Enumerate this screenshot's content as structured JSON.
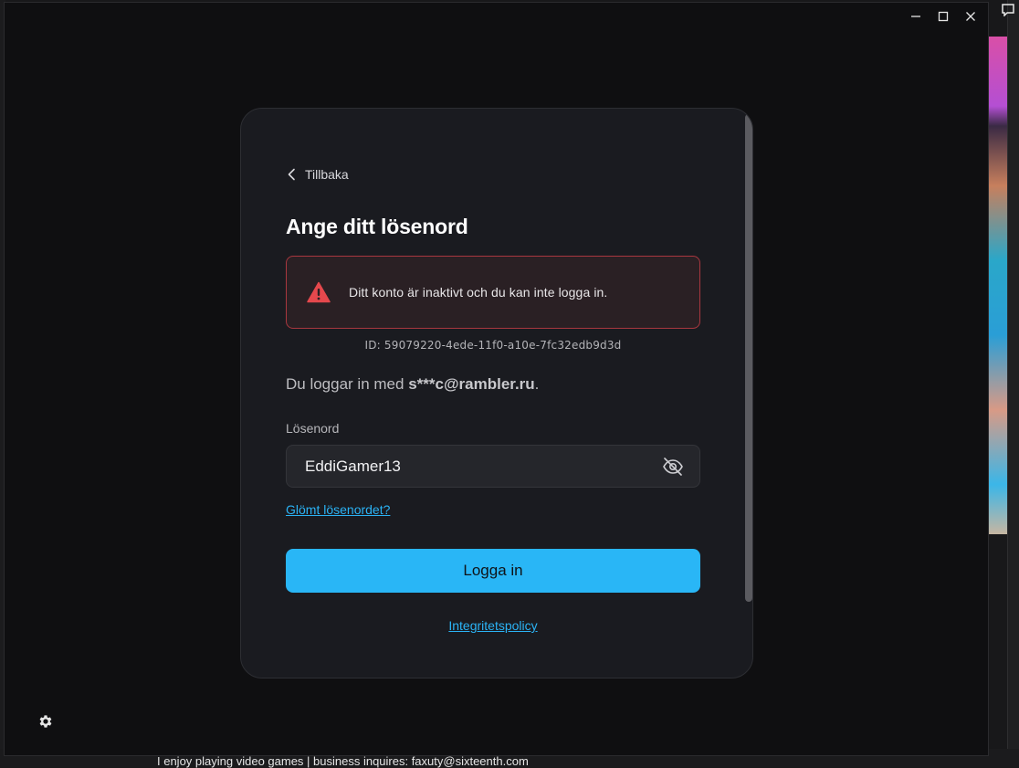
{
  "dialog": {
    "back_label": "Tillbaka",
    "title": "Ange ditt lösenord",
    "error": {
      "message": "Ditt konto är inaktivt och du kan inte logga in.",
      "id_text": "ID: 59079220-4ede-11f0-a10e-7fc32edb9d3d",
      "icon": "warning-triangle-icon",
      "color": "#e5484d"
    },
    "login_prefix": "Du loggar in med ",
    "login_email": "s***c@rambler.ru",
    "login_suffix": ".",
    "password_label": "Lösenord",
    "password_value": "EddiGamer13",
    "forgot_label": "Glömt lösenordet?",
    "login_button": "Logga in",
    "privacy_label": "Integritetspolicy"
  },
  "background": {
    "bottom_text": "I enjoy playing video games | business inquires: faxuty@sixteenth.com"
  },
  "colors": {
    "accent": "#29b6f6",
    "link": "#2bb3f5",
    "error_border": "#a8373f"
  }
}
